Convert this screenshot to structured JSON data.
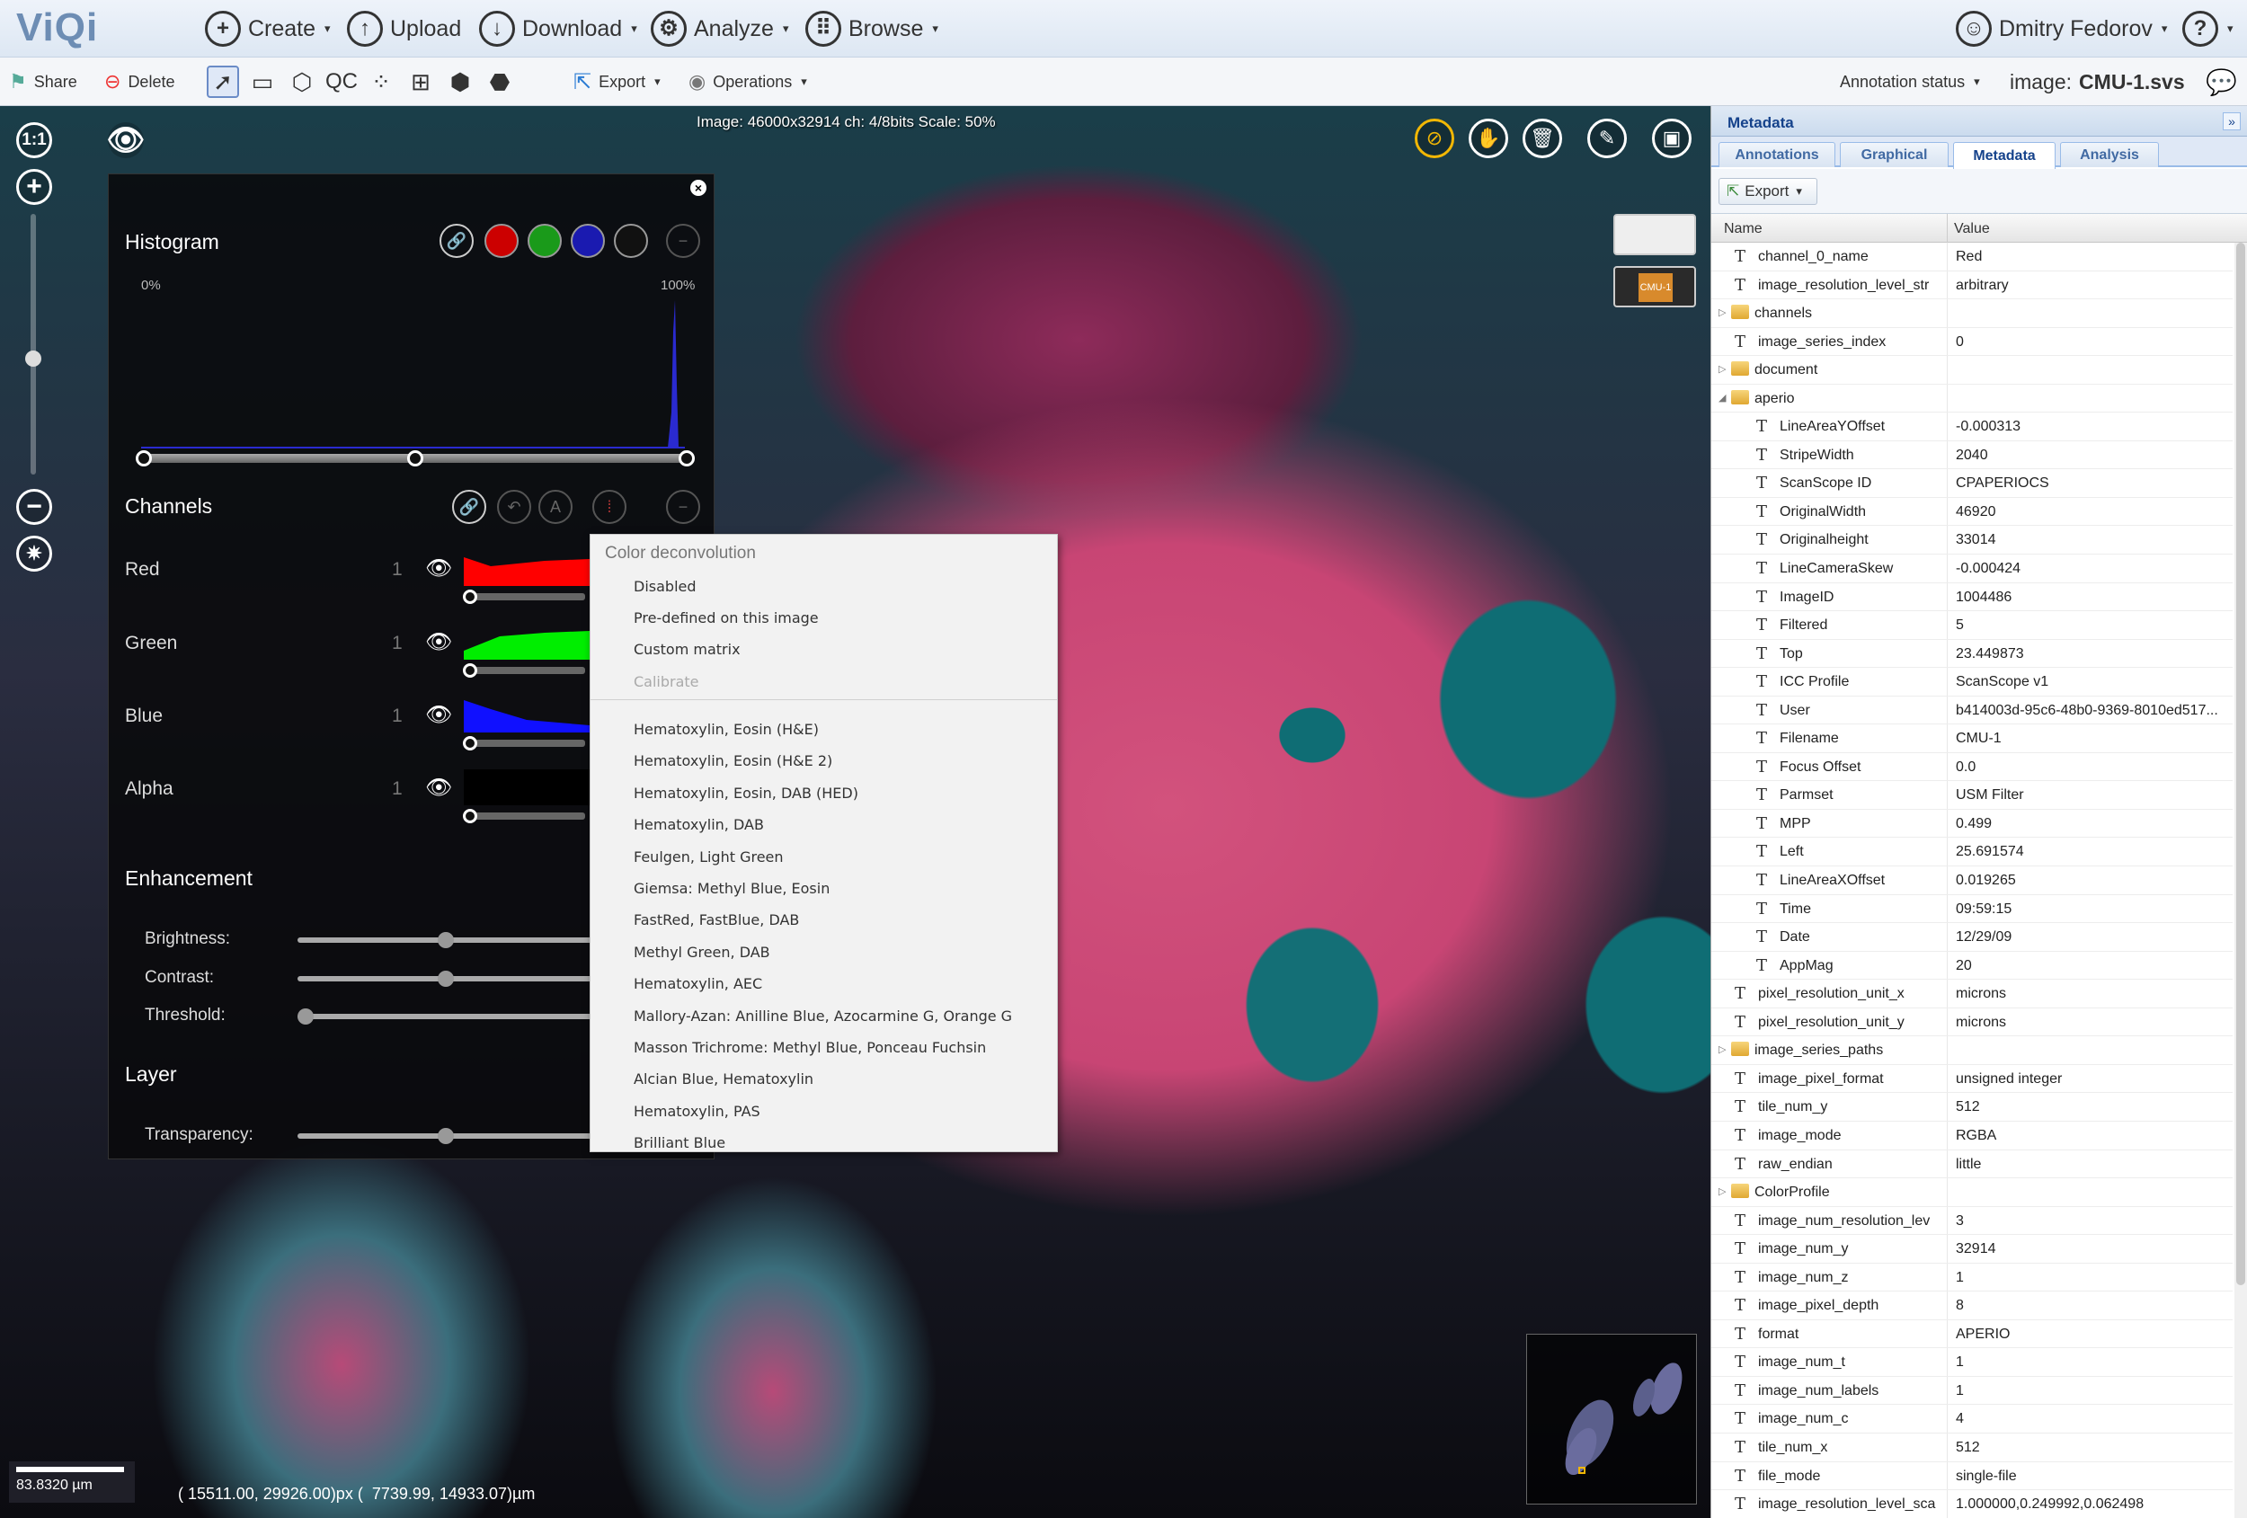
{
  "app": {
    "logo": "ViQi",
    "nav": {
      "create": "Create",
      "upload": "Upload",
      "download": "Download",
      "analyze": "Analyze",
      "browse": "Browse",
      "user": "Dmitry Fedorov",
      "help": "?"
    }
  },
  "toolbar": {
    "share": "Share",
    "delete": "Delete",
    "qc": "QC",
    "export": "Export",
    "operations": "Operations",
    "annotation_status": "Annotation status",
    "image_label": "image:",
    "image_name": "CMU-1.svs"
  },
  "viewer": {
    "info": "Image: 46000x32914 ch: 4/8bits Scale: 50%",
    "zoom_1to1": "1:1",
    "zoom_in": "+",
    "zoom_out": "−",
    "scale_text": "83.8320 µm",
    "coords": "( 15511.00, 29926.00)px (  7739.99, 14933.07)µm",
    "thumb2_label": "CMU-1"
  },
  "histogram_panel": {
    "histogram_title": "Histogram",
    "pct_min": "0%",
    "pct_max": "100%",
    "channels_title": "Channels",
    "channels": [
      {
        "name": "Red",
        "num": "1",
        "color": "#ff0000"
      },
      {
        "name": "Green",
        "num": "1",
        "color": "#00ee00"
      },
      {
        "name": "Blue",
        "num": "1",
        "color": "#1010ff"
      },
      {
        "name": "Alpha",
        "num": "1",
        "color": "#000000"
      }
    ],
    "enhancement_title": "Enhancement",
    "brightness": "Brightness:",
    "contrast": "Contrast:",
    "threshold": "Threshold:",
    "layer_title": "Layer",
    "transparency": "Transparency:",
    "levels": {
      "brightness": 0.5,
      "contrast": 0.5,
      "threshold": 0.0,
      "transparency": 0.5
    }
  },
  "deconv_menu": {
    "header": "Color deconvolution",
    "items": [
      "Disabled",
      "Pre-defined on this image",
      "Custom matrix",
      "Calibrate"
    ],
    "stains": [
      "Hematoxylin, Eosin (H&E)",
      "Hematoxylin, Eosin (H&E 2)",
      "Hematoxylin, Eosin, DAB (HED)",
      "Hematoxylin, DAB",
      "Feulgen, Light Green",
      "Giemsa: Methyl Blue, Eosin",
      "FastRed, FastBlue, DAB",
      "Methyl Green, DAB",
      "Hematoxylin, AEC",
      "Mallory-Azan: Anilline Blue, Azocarmine G, Orange G",
      "Masson Trichrome: Methyl Blue, Ponceau Fuchsin",
      "Alcian Blue, Hematoxylin",
      "Hematoxylin, PAS",
      "Brilliant Blue"
    ]
  },
  "right_panel": {
    "title": "Metadata",
    "tabs": [
      "Annotations",
      "Graphical",
      "Metadata",
      "Analysis"
    ],
    "export": "Export",
    "col_name": "Name",
    "col_value": "Value",
    "rows": [
      {
        "n": "channel_0_name",
        "v": "Red",
        "t": "T",
        "d": 0
      },
      {
        "n": "image_resolution_level_str",
        "v": "arbitrary",
        "t": "T",
        "d": 0
      },
      {
        "n": "channels",
        "v": "",
        "t": "F",
        "d": 0
      },
      {
        "n": "image_series_index",
        "v": "0",
        "t": "T",
        "d": 0
      },
      {
        "n": "document",
        "v": "",
        "t": "F",
        "d": 0
      },
      {
        "n": "aperio",
        "v": "",
        "t": "FO",
        "d": 0
      },
      {
        "n": "LineAreaYOffset",
        "v": "-0.000313",
        "t": "T",
        "d": 1
      },
      {
        "n": "StripeWidth",
        "v": "2040",
        "t": "T",
        "d": 1
      },
      {
        "n": "ScanScope ID",
        "v": "CPAPERIOCS",
        "t": "T",
        "d": 1
      },
      {
        "n": "OriginalWidth",
        "v": "46920",
        "t": "T",
        "d": 1
      },
      {
        "n": "Originalheight",
        "v": "33014",
        "t": "T",
        "d": 1
      },
      {
        "n": "LineCameraSkew",
        "v": "-0.000424",
        "t": "T",
        "d": 1
      },
      {
        "n": "ImageID",
        "v": "1004486",
        "t": "T",
        "d": 1
      },
      {
        "n": "Filtered",
        "v": "5",
        "t": "T",
        "d": 1
      },
      {
        "n": "Top",
        "v": "23.449873",
        "t": "T",
        "d": 1
      },
      {
        "n": "ICC Profile",
        "v": "ScanScope v1",
        "t": "T",
        "d": 1
      },
      {
        "n": "User",
        "v": "b414003d-95c6-48b0-9369-8010ed517...",
        "t": "T",
        "d": 1
      },
      {
        "n": "Filename",
        "v": "CMU-1",
        "t": "T",
        "d": 1
      },
      {
        "n": "Focus Offset",
        "v": "0.0",
        "t": "T",
        "d": 1
      },
      {
        "n": "Parmset",
        "v": "USM Filter",
        "t": "T",
        "d": 1
      },
      {
        "n": "MPP",
        "v": "0.499",
        "t": "T",
        "d": 1
      },
      {
        "n": "Left",
        "v": "25.691574",
        "t": "T",
        "d": 1
      },
      {
        "n": "LineAreaXOffset",
        "v": "0.019265",
        "t": "T",
        "d": 1
      },
      {
        "n": "Time",
        "v": "09:59:15",
        "t": "T",
        "d": 1
      },
      {
        "n": "Date",
        "v": "12/29/09",
        "t": "T",
        "d": 1
      },
      {
        "n": "AppMag",
        "v": "20",
        "t": "T",
        "d": 1
      },
      {
        "n": "pixel_resolution_unit_x",
        "v": "microns",
        "t": "T",
        "d": 0
      },
      {
        "n": "pixel_resolution_unit_y",
        "v": "microns",
        "t": "T",
        "d": 0
      },
      {
        "n": "image_series_paths",
        "v": "",
        "t": "F",
        "d": 0
      },
      {
        "n": "image_pixel_format",
        "v": "unsigned integer",
        "t": "T",
        "d": 0
      },
      {
        "n": "tile_num_y",
        "v": "512",
        "t": "T",
        "d": 0
      },
      {
        "n": "image_mode",
        "v": "RGBA",
        "t": "T",
        "d": 0
      },
      {
        "n": "raw_endian",
        "v": "little",
        "t": "T",
        "d": 0
      },
      {
        "n": "ColorProfile",
        "v": "",
        "t": "F",
        "d": 0
      },
      {
        "n": "image_num_resolution_lev",
        "v": "3",
        "t": "T",
        "d": 0
      },
      {
        "n": "image_num_y",
        "v": "32914",
        "t": "T",
        "d": 0
      },
      {
        "n": "image_num_z",
        "v": "1",
        "t": "T",
        "d": 0
      },
      {
        "n": "image_pixel_depth",
        "v": "8",
        "t": "T",
        "d": 0
      },
      {
        "n": "format",
        "v": "APERIO",
        "t": "T",
        "d": 0
      },
      {
        "n": "image_num_t",
        "v": "1",
        "t": "T",
        "d": 0
      },
      {
        "n": "image_num_labels",
        "v": "1",
        "t": "T",
        "d": 0
      },
      {
        "n": "image_num_c",
        "v": "4",
        "t": "T",
        "d": 0
      },
      {
        "n": "tile_num_x",
        "v": "512",
        "t": "T",
        "d": 0
      },
      {
        "n": "file_mode",
        "v": "single-file",
        "t": "T",
        "d": 0
      },
      {
        "n": "image_resolution_level_sca",
        "v": "1.000000,0.249992,0.062498",
        "t": "T",
        "d": 0
      }
    ]
  },
  "colors": {
    "accent": "#15428b",
    "nav_bg": "#dde7f3",
    "tissue_pink": "#d2527d",
    "tissue_teal": "#0f6d74"
  }
}
